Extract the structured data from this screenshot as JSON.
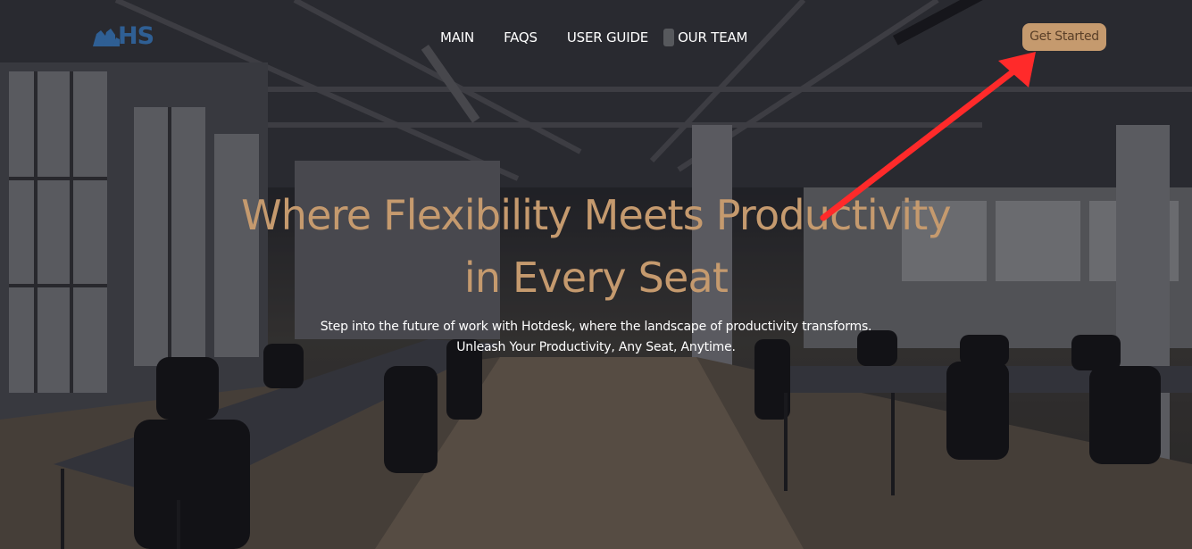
{
  "brand": {
    "logo_text": "HS",
    "logo_icon": "buildings-icon",
    "color": "#2f5f94"
  },
  "nav": {
    "items": [
      {
        "label": "MAIN"
      },
      {
        "label": "FAQS"
      },
      {
        "label": "USER GUIDE"
      },
      {
        "label": "OUR TEAM"
      }
    ],
    "cta_label": "Get Started"
  },
  "hero": {
    "headline_line1": "Where Flexibility Meets Productivity",
    "headline_line2": "in Every Seat",
    "subtext_line1": "Step into the future of work with Hotdesk, where the landscape of productivity transforms.",
    "subtext_line2": "Unleash Your Productivity, Any Seat, Anytime."
  },
  "colors": {
    "accent": "#c59a6e",
    "annotation": "#ff2a2a",
    "text_light": "#ffffff"
  },
  "annotation": {
    "type": "arrow",
    "points_to": "get-started-button"
  }
}
